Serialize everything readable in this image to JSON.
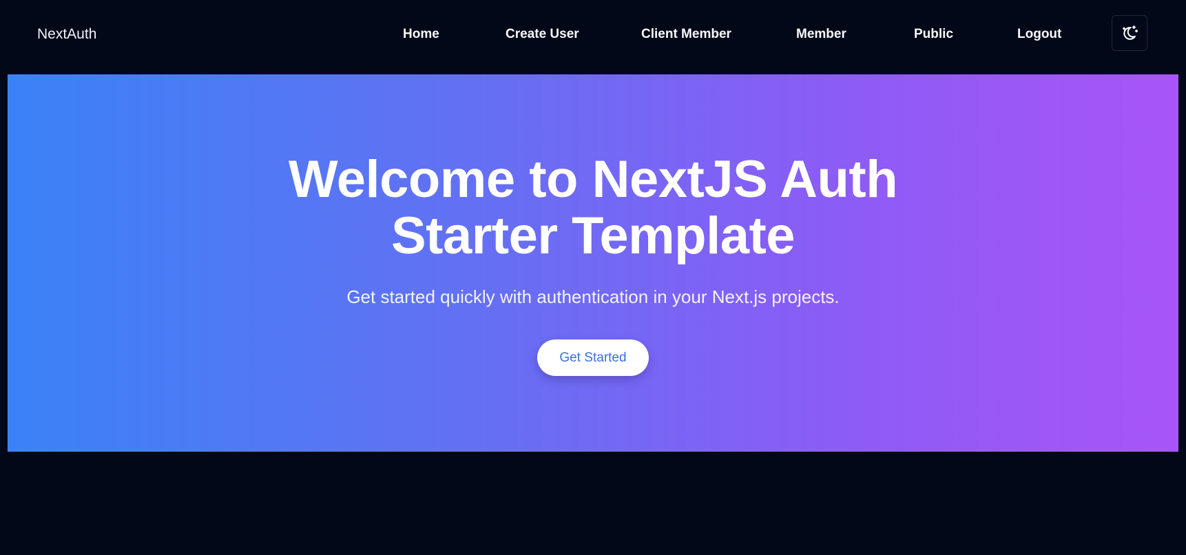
{
  "header": {
    "brand": "NextAuth",
    "nav": [
      {
        "label": "Home"
      },
      {
        "label": "Create User"
      },
      {
        "label": "Client Member"
      },
      {
        "label": "Member"
      },
      {
        "label": "Public"
      },
      {
        "label": "Logout"
      }
    ],
    "theme_toggle_icon": "moon-stars-icon"
  },
  "hero": {
    "title_line1": "Welcome to NextJS Auth",
    "title_line2": "Starter Template",
    "subtitle": "Get started quickly with authentication in your Next.js projects.",
    "cta_label": "Get Started"
  },
  "colors": {
    "page_background": "#020817",
    "hero_gradient_start": "#3b82f6",
    "hero_gradient_end": "#a855f7",
    "cta_text": "#3b6fd8"
  }
}
